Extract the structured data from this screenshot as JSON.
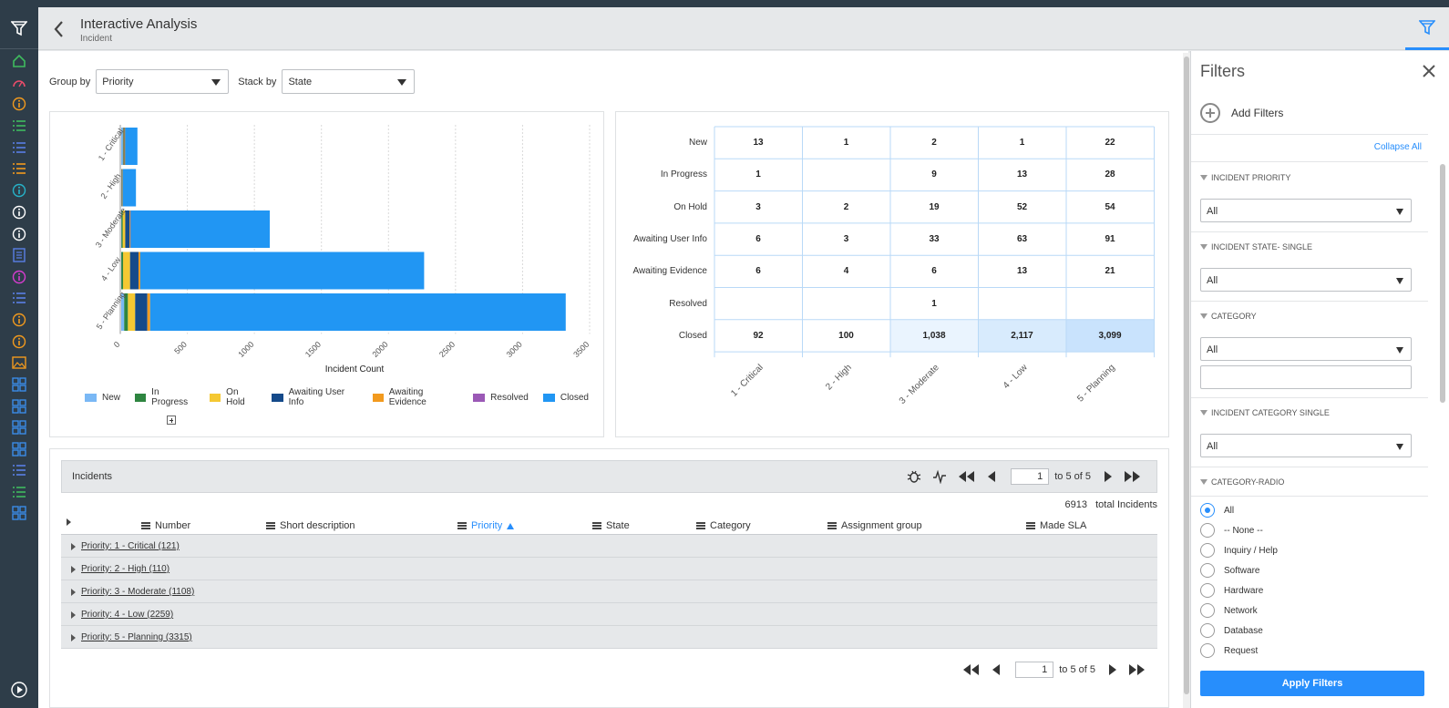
{
  "header": {
    "title": "Interactive Analysis",
    "subtitle": "Incident"
  },
  "controls": {
    "group_by_label": "Group by",
    "group_by_value": "Priority",
    "stack_by_label": "Stack by",
    "stack_by_value": "State"
  },
  "chart_data": {
    "type": "bar",
    "orientation": "horizontal",
    "stacked": true,
    "categories": [
      "1 - Critical",
      "2 - High",
      "3 - Moderate",
      "4 - Low",
      "5 - Planning"
    ],
    "series": [
      {
        "name": "New",
        "color": "#7ab8f5",
        "values": [
          13,
          1,
          2,
          1,
          22
        ]
      },
      {
        "name": "In Progress",
        "color": "#2e8540",
        "values": [
          1,
          0,
          9,
          13,
          28
        ]
      },
      {
        "name": "On Hold",
        "color": "#f5c832",
        "values": [
          3,
          2,
          19,
          52,
          54
        ]
      },
      {
        "name": "Awaiting User Info",
        "color": "#154a8a",
        "values": [
          6,
          3,
          33,
          63,
          91
        ]
      },
      {
        "name": "Awaiting Evidence",
        "color": "#f29a1e",
        "values": [
          6,
          4,
          6,
          13,
          21
        ]
      },
      {
        "name": "Resolved",
        "color": "#9b59b6",
        "values": [
          0,
          0,
          1,
          0,
          0
        ]
      },
      {
        "name": "Closed",
        "color": "#2196f3",
        "values": [
          92,
          100,
          1038,
          2117,
          3099
        ]
      }
    ],
    "xlabel": "Incident Count",
    "xlim": [
      0,
      3500
    ],
    "xticks": [
      "0",
      "500",
      "1000",
      "1500",
      "2000",
      "2500",
      "3000",
      "3500"
    ],
    "grid": true,
    "legend": "bottom"
  },
  "pivot": {
    "rows": [
      "New",
      "In Progress",
      "On Hold",
      "Awaiting User Info",
      "Awaiting Evidence",
      "Resolved",
      "Closed"
    ],
    "cols": [
      "1 - Critical",
      "2 - High",
      "3 - Moderate",
      "4 - Low",
      "5 - Planning"
    ],
    "cells": [
      [
        "13",
        "1",
        "2",
        "1",
        "22"
      ],
      [
        "1",
        "",
        "9",
        "13",
        "28"
      ],
      [
        "3",
        "2",
        "19",
        "52",
        "54"
      ],
      [
        "6",
        "3",
        "33",
        "63",
        "91"
      ],
      [
        "6",
        "4",
        "6",
        "13",
        "21"
      ],
      [
        "",
        "",
        "1",
        "",
        ""
      ],
      [
        "92",
        "100",
        "1,038",
        "2,117",
        "3,099"
      ]
    ]
  },
  "list": {
    "title": "Incidents",
    "page_value": "1",
    "page_of": "to 5 of 5",
    "total_count": "6913",
    "total_label": "total Incidents",
    "columns": [
      "Number",
      "Short description",
      "Priority",
      "State",
      "Category",
      "Assignment group",
      "Made SLA"
    ],
    "groups": [
      "Priority: 1 - Critical (121)",
      "Priority: 2 - High (110)",
      "Priority: 3 - Moderate (1108)",
      "Priority: 4 - Low (2259)",
      "Priority: 5 - Planning (3315)"
    ]
  },
  "filters": {
    "title": "Filters",
    "add_label": "Add Filters",
    "collapse_label": "Collapse All",
    "sections": [
      {
        "label": "INCIDENT PRIORITY",
        "value": "All"
      },
      {
        "label": "INCIDENT STATE- SINGLE",
        "value": "All"
      },
      {
        "label": "CATEGORY",
        "value": "All"
      },
      {
        "label": "INCIDENT CATEGORY SINGLE",
        "value": "All"
      },
      {
        "label": "CATEGORY-RADIO"
      }
    ],
    "radios": [
      "All",
      "-- None --",
      "Inquiry / Help",
      "Software",
      "Hardware",
      "Network",
      "Database",
      "Request"
    ],
    "apply_label": "Apply Filters"
  }
}
